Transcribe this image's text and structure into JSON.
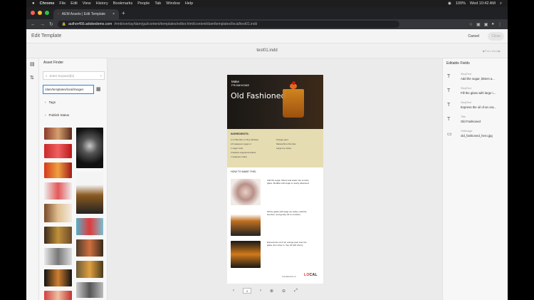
{
  "menubar": {
    "apple": "",
    "app": "Chrome",
    "items": [
      "File",
      "Edit",
      "View",
      "History",
      "Bookmarks",
      "People",
      "Tab",
      "Window",
      "Help"
    ],
    "battery": "100%",
    "clock": "Wed 10:42 AM"
  },
  "browser": {
    "tab_title": "AEM Assets | Edit Template",
    "url_host": "author456.adobedemo.com",
    "url_path": "/mnt/overlay/dam/gui/content/templates/editor.html/content/dam/templates/local/test01.indd"
  },
  "header": {
    "title": "Edit Template",
    "cancel": "Cancel",
    "close": "Close",
    "doc_name": "test01.indd",
    "nav": "◀ Prev  Next ▶"
  },
  "finder": {
    "title": "Asset Finder",
    "search_placeholder": "Enter Keyword(s)",
    "path": "/dam/templates/local/images",
    "accordions": [
      "Tags",
      "Publish Status"
    ]
  },
  "document": {
    "make_line1": "Make",
    "make_line2": "FROMHOME",
    "title": "Old Fashioned",
    "ingredients_heading": "INGREDIENTS:",
    "ingredients_left": [
      "2 oz Bourbon or Rye whiskey",
      "1/2 teaspoon sugar or",
      "1 sugar cube",
      "3 dashes Angostura bitters",
      "1 teaspoon water"
    ],
    "ingredients_right": [
      "Orange peel",
      "Maraschino Cherries",
      "Large ice cubes"
    ],
    "how_heading": "HOW TO MAKE THIS:",
    "steps": [
      "Add the sugar, bitters and water into a rocks glass. Muddle until sugar is nearly dissolved.",
      "Fill the glass with large ice cubes, add the bourbon, and gently stir to combine.",
      "Express the oil of an orange peel over the glass, then drop in. Top off with cherry."
    ],
    "footer_prefix": "Compliments of",
    "brand_lo": "LO",
    "brand_cal": "CAL"
  },
  "toolbar": {
    "prev": "‹",
    "page": "1",
    "next": "›",
    "zoom_in": "⊕",
    "zoom_out": "⊖",
    "fit": "⤢"
  },
  "fields": {
    "title": "Editable Fields",
    "items": [
      {
        "key": "StepText",
        "value": "Add the sugar, bitters a..."
      },
      {
        "key": "StepText",
        "value": "Fill the glass with large i..."
      },
      {
        "key": "StepText",
        "value": "Express the oil of an ora..."
      },
      {
        "key": "Title",
        "value": "Old Fashioned"
      },
      {
        "key": "OldImage",
        "value": "old_fashioned_hero.jpg"
      }
    ]
  }
}
